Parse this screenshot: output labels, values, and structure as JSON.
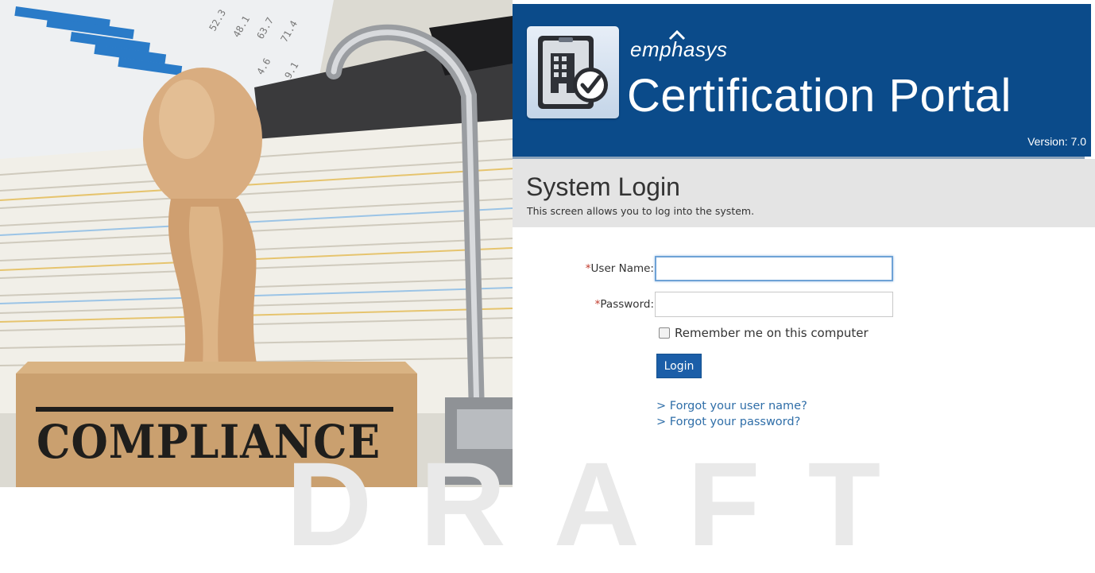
{
  "hero": {
    "stamp_text": "COMPLIANCE"
  },
  "banner": {
    "brand": "emphasys",
    "product": "Certification Portal",
    "version": "Version: 7.0",
    "color": "#0b4b8a"
  },
  "page": {
    "title": "System Login",
    "subtitle": "This screen allows you to log into the system."
  },
  "form": {
    "required_marker": "*",
    "username_label": "User Name:",
    "username_value": "",
    "password_label": "Password:",
    "password_value": "",
    "remember_label": "Remember me on this computer",
    "remember_checked": false,
    "login_button": "Login"
  },
  "links": {
    "forgot_username": "> Forgot your user name?",
    "forgot_password": "> Forgot your password?"
  },
  "watermark": "DRAFT",
  "icons": [
    "building-certificate-logo-icon",
    "checkmark-badge-icon"
  ]
}
